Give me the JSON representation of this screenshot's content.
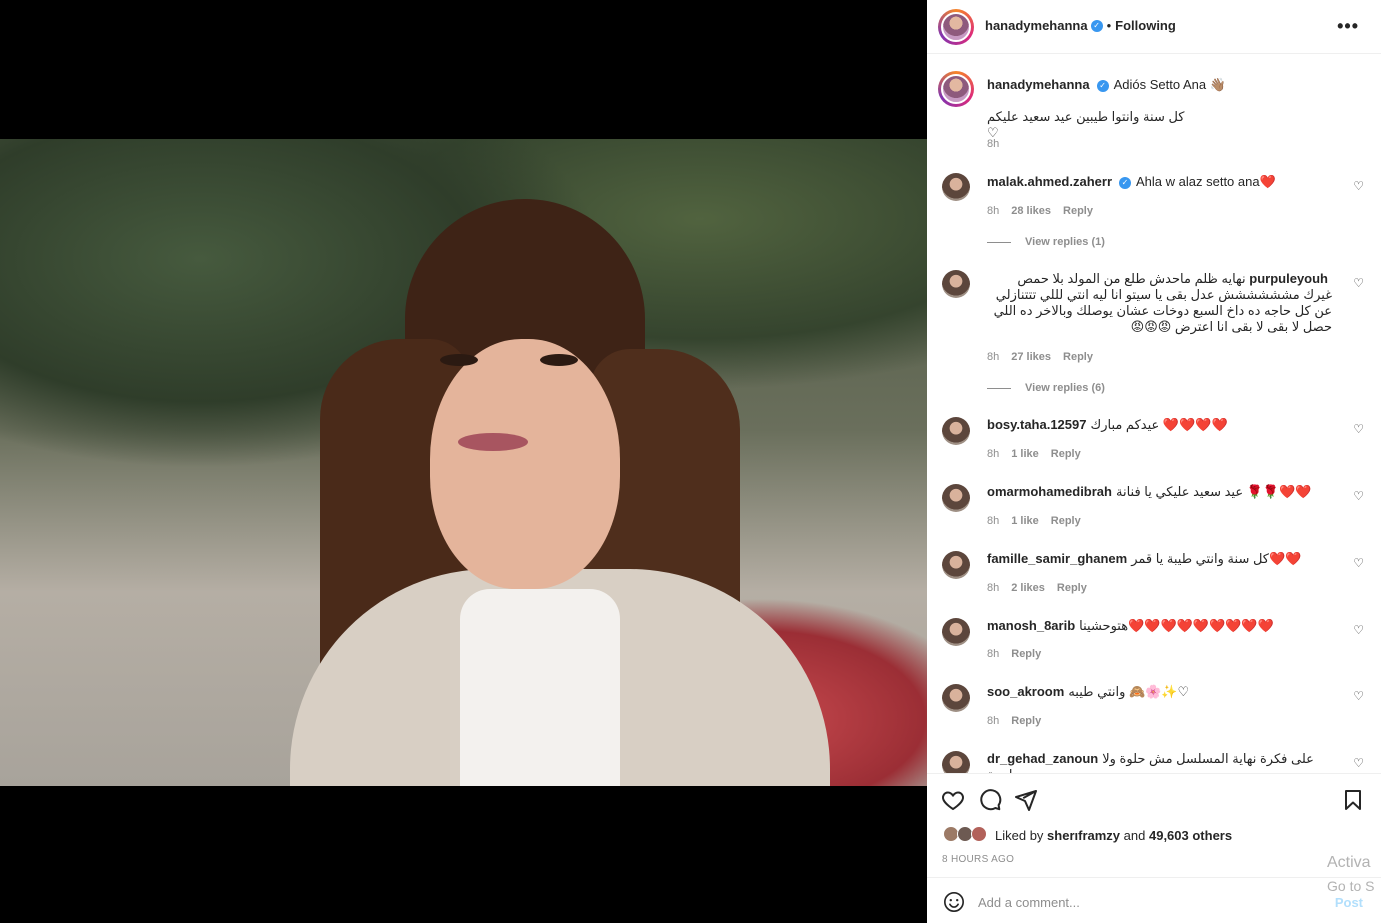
{
  "post": {
    "author": "hanadymehanna",
    "follow_status": "Following",
    "more_glyph": "•••",
    "caption_text": "Adiós Setto Ana 👋🏽",
    "caption_line2": "كل سنة وانتوا طيبين عيد سعيد عليكم ♡",
    "caption_time": "8h"
  },
  "comments": [
    {
      "user": "malak.ahmed.zaherr",
      "verified": true,
      "text": "Ahla w alaz setto ana❤️",
      "time": "8h",
      "likes": "28 likes",
      "reply": "Reply",
      "view_replies": "View replies (1)"
    },
    {
      "user": "purpuleyouh",
      "verified": false,
      "text": "نهايه ظلم ماحدش طلع من المولد بلا حمص غيرك مشششششش عدل بقى يا سيتو انا ليه انتي لللي تتتنازلي عن كل حاجه ده داخ السبع دوخات عشان يوصلك وبالاخر ده اللي حصل لا بقى لا بقى انا اعترض 😡😡😡",
      "time": "8h",
      "likes": "27 likes",
      "reply": "Reply",
      "view_replies": "View replies (6)"
    },
    {
      "user": "bosy.taha.12597",
      "verified": false,
      "text": "عيدكم مبارك ❤️❤️❤️❤️",
      "time": "8h",
      "likes": "1 like",
      "reply": "Reply"
    },
    {
      "user": "omarmohamedibrah",
      "verified": false,
      "text": "عيد سعيد عليكي يا فنانة 🌹🌹❤️❤️",
      "time": "8h",
      "likes": "1 like",
      "reply": "Reply"
    },
    {
      "user": "famille_samir_ghanem",
      "verified": false,
      "text": "كل سنة وانتي طيبة يا قمر❤️❤️",
      "time": "8h",
      "likes": "2 likes",
      "reply": "Reply"
    },
    {
      "user": "manosh_8arib",
      "verified": false,
      "text": "هتوحشينا❤️❤️❤️❤️❤️❤️❤️❤️❤️",
      "time": "8h",
      "likes": "",
      "reply": "Reply"
    },
    {
      "user": "soo_akroom",
      "verified": false,
      "text": "وانتي طيبه 🙈🌸✨♡",
      "time": "8h",
      "likes": "",
      "reply": "Reply"
    },
    {
      "user": "dr_gehad_zanoun",
      "verified": false,
      "text": "على فكرة نهاية المسلسل مش حلوة ولا راضية",
      "time": "",
      "likes": "",
      "reply": ""
    }
  ],
  "actions": {
    "liked_by_prefix": "Liked by",
    "liked_by_user": "sherıframzy",
    "liked_by_and": "and",
    "liked_by_count": "49,603 others",
    "time_ago": "8 HOURS AGO"
  },
  "composer": {
    "placeholder": "Add a comment...",
    "post_label": "Post"
  },
  "watermark": {
    "line1": "Activa",
    "line2": "Go to S"
  },
  "icons": {
    "like": "heart-icon",
    "comment": "comment-icon",
    "share": "share-icon",
    "save": "bookmark-icon",
    "emoji": "emoji-icon",
    "more": "more-icon",
    "verified": "verified-icon"
  }
}
